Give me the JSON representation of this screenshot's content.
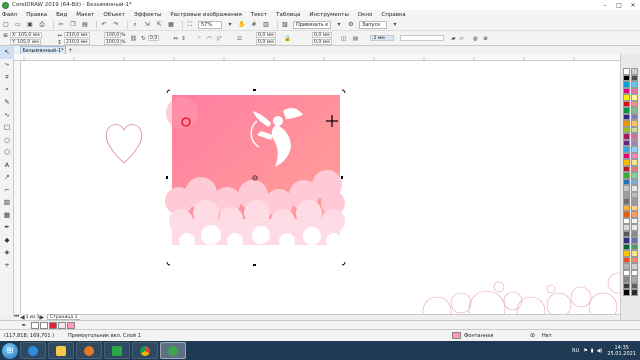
{
  "window": {
    "title": "CorelDRAW 2019 (64-Bit) - Безымянный-1*",
    "buttons": [
      "–",
      "□",
      "✕"
    ]
  },
  "menu": [
    "Файл",
    "Правка",
    "Вид",
    "Макет",
    "Объект",
    "Эффекты",
    "Растровые изображения",
    "Текст",
    "Таблица",
    "Инструменты",
    "Окно",
    "Справка"
  ],
  "toolbar": {
    "zoom": "57%",
    "snap": "Привязать к",
    "launch": "Запуск"
  },
  "propbar": {
    "x": "X: 105,0 мм",
    "y": "Y: 105,0 мм",
    "w": "210,0 мм",
    "h": "210,0 мм",
    "sx": "100,0",
    "sy": "100,0",
    "pct": "%",
    "angle": "0,0",
    "c1": "0,0 мм",
    "c2": "0,0 мм",
    "c3": "0,0 мм",
    "c4": "0,0 мм",
    "outline": ".2 мм"
  },
  "doc_tab": "Безымянный-1*",
  "page_nav": {
    "page_label": "Страница 1",
    "counter": "1 из 1"
  },
  "status": {
    "coords": "(117,818; 169,701 )",
    "info": "Прямоугольник вкл. Слой 1",
    "fill_label": "Фонтанная",
    "outline_label": "Нет"
  },
  "taskbar": {
    "lang": "RU",
    "time": "14:35",
    "date": "25.01.2021"
  },
  "colors": {
    "accent": "#ff7fa0",
    "selection_outline": "#000000"
  }
}
